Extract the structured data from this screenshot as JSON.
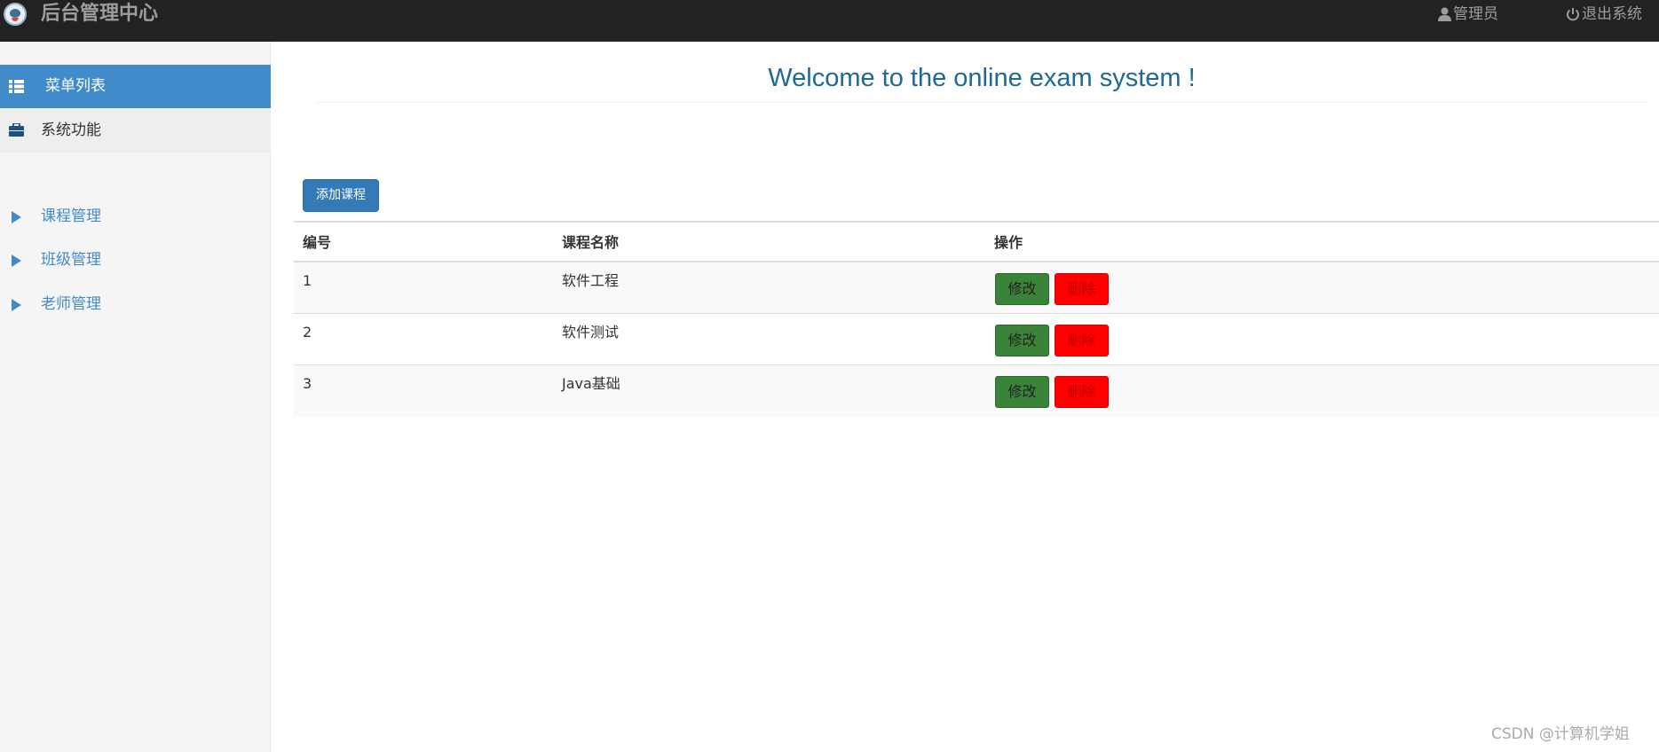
{
  "header": {
    "title": "后台管理中心",
    "admin_label": "管理员",
    "logout_label": "退出系统"
  },
  "sidebar": {
    "menu_title": "菜单列表",
    "section_title": "系统功能",
    "items": [
      {
        "label": "课程管理"
      },
      {
        "label": "班级管理"
      },
      {
        "label": "老师管理"
      }
    ]
  },
  "main": {
    "welcome": "Welcome to the online exam system !",
    "add_button": "添加课程",
    "table": {
      "headers": [
        "编号",
        "课程名称",
        "操作"
      ],
      "rows": [
        {
          "id": "1",
          "name": "软件工程"
        },
        {
          "id": "2",
          "name": "软件测试"
        },
        {
          "id": "3",
          "name": "Java基础"
        }
      ],
      "edit_label": "修改",
      "delete_label": "删除"
    }
  },
  "watermark": "CSDN @计算机学姐",
  "colors": {
    "navbar": "#222222",
    "primary": "#428bca",
    "edit": "#398439",
    "delete": "#ff0000",
    "welcome": "#1f6996"
  }
}
